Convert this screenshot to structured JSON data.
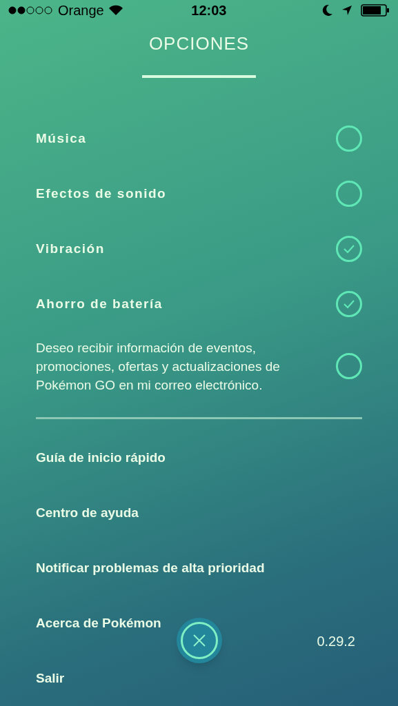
{
  "status_bar": {
    "carrier": "Orange",
    "time": "12:03"
  },
  "title": "OPCIONES",
  "toggles": [
    {
      "label": "Música",
      "checked": false
    },
    {
      "label": "Efectos de sonido",
      "checked": false
    },
    {
      "label": "Vibración",
      "checked": true
    },
    {
      "label": "Ahorro de batería",
      "checked": true
    },
    {
      "label": "Deseo recibir información de eventos, promociones, ofertas y actualizaciones de Pokémon GO en mi correo electrónico.",
      "checked": false,
      "kind": "paragraph"
    }
  ],
  "menu": [
    "Guía de inicio rápido",
    "Centro de ayuda",
    "Notificar problemas de alta prioridad",
    "Acerca de Pokémon",
    "Salir"
  ],
  "version": "0.29.2"
}
